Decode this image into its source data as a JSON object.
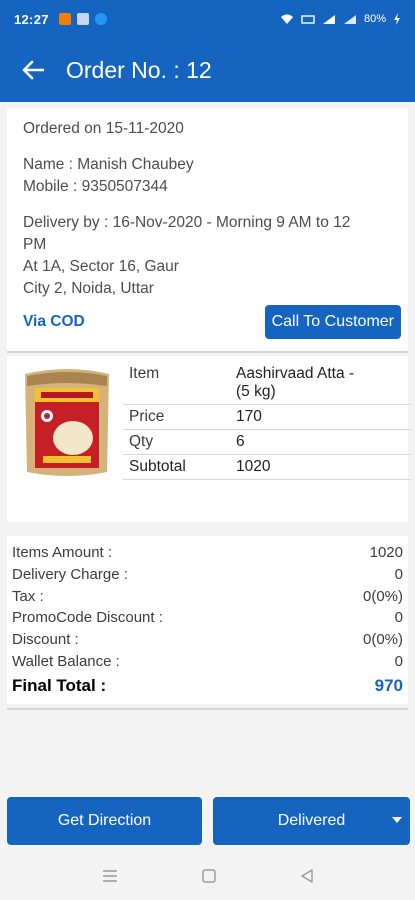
{
  "status_bar": {
    "time": "12:27",
    "battery": "80%"
  },
  "header": {
    "title": "Order No. : 12"
  },
  "order": {
    "ordered_on": "Ordered on 15-11-2020",
    "name": "Name : Manish Chaubey",
    "mobile": "Mobile : 9350507344",
    "delivery_by": "Delivery by : 16-Nov-2020 - Morning 9 AM to 12",
    "delivery_by_cont": "PM",
    "address_1": "At 1A, Sector 16, Gaur",
    "address_2": "City 2, Noida, Uttar",
    "payment_mode": "Via COD",
    "call_label": "Call To Customer"
  },
  "item": {
    "image_icon": "product-image-icon",
    "rows": [
      {
        "key": "Item",
        "value": "Aashirvaad Atta -",
        "value_cont": "(5 kg)"
      },
      {
        "key": "Price",
        "value": "170"
      },
      {
        "key": "Qty",
        "value": "6"
      },
      {
        "key": "Subtotal",
        "value": "1020"
      }
    ]
  },
  "summary": {
    "rows": [
      {
        "label": "Items Amount :",
        "value": "1020"
      },
      {
        "label": "Delivery Charge :",
        "value": "0"
      },
      {
        "label": "Tax :",
        "value": "0(0%)"
      },
      {
        "label": "PromoCode Discount :",
        "value": "0"
      },
      {
        "label": "Discount :",
        "value": "0(0%)"
      },
      {
        "label": "Wallet Balance :",
        "value": "0"
      }
    ],
    "final_label": "Final Total :",
    "final_value": "970"
  },
  "actions": {
    "direction_label": "Get Direction",
    "delivered_label": "Delivered"
  },
  "colors": {
    "primary": "#1565c0",
    "background": "#f3f3f3"
  }
}
